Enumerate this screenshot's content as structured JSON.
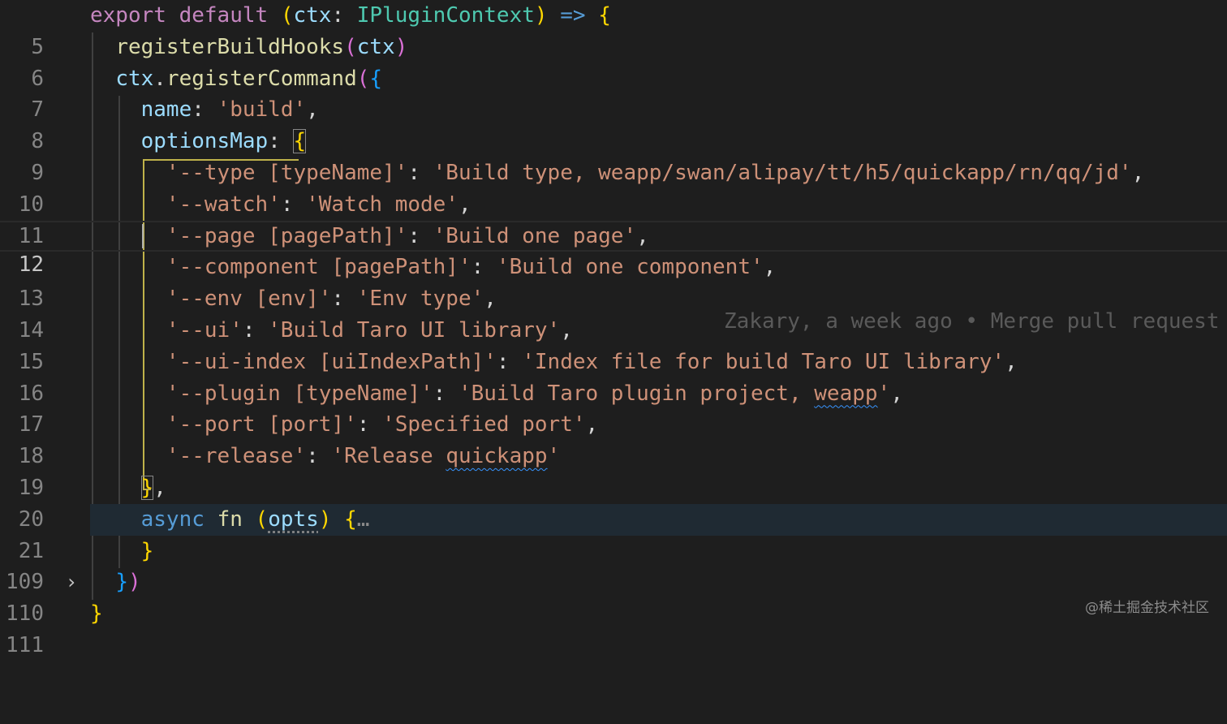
{
  "editor": {
    "line_numbers": [
      "5",
      "6",
      "7",
      "8",
      "9",
      "10",
      "11",
      "12",
      "13",
      "14",
      "15",
      "16",
      "17",
      "18",
      "19",
      "20",
      "21",
      "109",
      "110",
      "111"
    ],
    "fold_icon": "chevron-right-icon",
    "folded_ellipsis": "…",
    "blame": "Zakary, a week ago • Merge pull request",
    "t": {
      "l5_export": "export",
      "l5_default": "default",
      "l5_ctx": "ctx",
      "l5_colon": ":",
      "l5_type": "IPluginContext",
      "l5_arrow": "=>",
      "l6_fn": "registerBuildHooks",
      "l6_arg": "ctx",
      "l7_obj": "ctx",
      "l7_dot": ".",
      "l7_fn": "registerCommand",
      "l8_key": "name",
      "l8_val": "'build'",
      "l9_key": "optionsMap",
      "l10_key": "'--type [typeName]'",
      "l10_val": "'Build type, weapp/swan/alipay/tt/h5/quickapp/rn/qq/jd'",
      "l11_key": "'--watch'",
      "l11_val": "'Watch mode'",
      "l12_key": "'--page [pagePath]'",
      "l12_val": "'Build one page'",
      "l13_key": "'--component [pagePath]'",
      "l13_val": "'Build one component'",
      "l14_key": "'--env [env]'",
      "l14_val": "'Env type'",
      "l15_key": "'--ui'",
      "l15_val": "'Build Taro UI library'",
      "l16_key": "'--ui-index [uiIndexPath]'",
      "l16_val": "'Index file for build Taro UI library'",
      "l17_key": "'--plugin [typeName]'",
      "l17_val_a": "'Build Taro plugin project, ",
      "l17_val_b": "weapp",
      "l17_val_c": "'",
      "l18_key": "'--port [port]'",
      "l18_val": "'Specified port'",
      "l19_key": "'--release'",
      "l19_val_a": "'Release ",
      "l19_val_b": "quickapp",
      "l19_val_c": "'",
      "l21_async": "async",
      "l21_fn": "fn",
      "l21_param": "opts"
    }
  },
  "watermark": "@稀土掘金技术社区"
}
